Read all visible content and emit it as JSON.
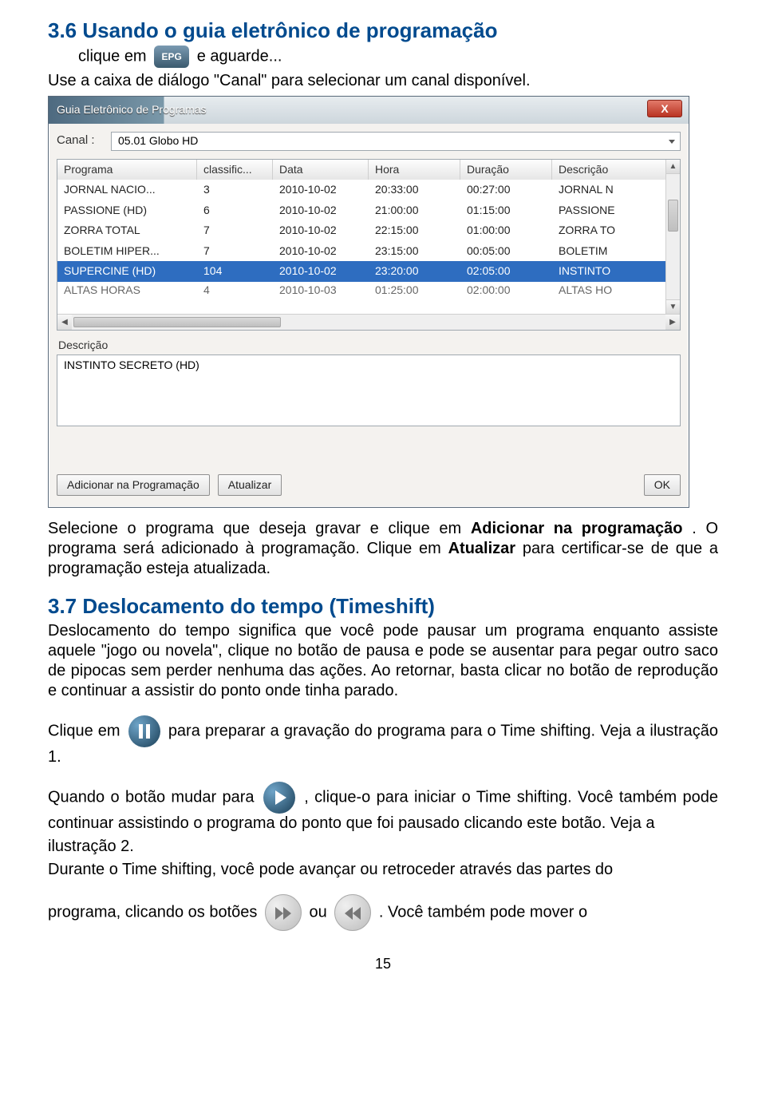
{
  "section36_title": "3.6 Usando o guia eletrônico de programação",
  "line36a_part1": "clique em ",
  "epg_icon_label": "EPG",
  "line36a_part2": " e  aguarde...",
  "line36b": "Use a caixa de diálogo \"Canal\" para selecionar um canal disponível.",
  "dialog": {
    "title": "Guia Eletrônico de Programas",
    "close": "X",
    "channel_label": "Canal :",
    "channel_value": "05.01 Globo HD",
    "columns": {
      "c0": "Programa",
      "c1": "classific...",
      "c2": "Data",
      "c3": "Hora",
      "c4": "Duração",
      "c5": "Descrição"
    },
    "rows": [
      {
        "c0": "JORNAL  NACIO...",
        "c1": "3",
        "c2": "2010-10-02",
        "c3": "20:33:00",
        "c4": "00:27:00",
        "c5": "JORNAL N"
      },
      {
        "c0": "PASSIONE (HD)",
        "c1": "6",
        "c2": "2010-10-02",
        "c3": "21:00:00",
        "c4": "01:15:00",
        "c5": "PASSIONE"
      },
      {
        "c0": "ZORRA TOTAL",
        "c1": "7",
        "c2": "2010-10-02",
        "c3": "22:15:00",
        "c4": "01:00:00",
        "c5": "ZORRA TO"
      },
      {
        "c0": "BOLETIM HIPER...",
        "c1": "7",
        "c2": "2010-10-02",
        "c3": "23:15:00",
        "c4": "00:05:00",
        "c5": "BOLETIM"
      },
      {
        "c0": "SUPERCINE (HD)",
        "c1": "104",
        "c2": "2010-10-02",
        "c3": "23:20:00",
        "c4": "02:05:00",
        "c5": "INSTINTO"
      },
      {
        "c0": "ALTAS HORAS",
        "c1": "4",
        "c2": "2010-10-03",
        "c3": "01:25:00",
        "c4": "02:00:00",
        "c5": "ALTAS HO"
      }
    ],
    "desc_label": "Descrição",
    "desc_value": "INSTINTO SECRETO (HD)",
    "btn_add": "Adicionar na Programação",
    "btn_refresh": "Atualizar",
    "btn_ok": "OK"
  },
  "after_dialog_p": "Selecione o programa que deseja gravar e clique em ",
  "after_dialog_bold1": "Adicionar na programação",
  "after_dialog_p2": ". O programa será adicionado à programação. Clique em ",
  "after_dialog_bold2": "Atualizar",
  "after_dialog_p3": " para certificar-se de que a programação esteja atualizada.",
  "section37_title": "3.7 Deslocamento do tempo (Timeshift)",
  "section37_body": "Deslocamento do tempo significa que você pode pausar um programa enquanto assiste aquele \"jogo ou novela\", clique no botão de pausa e pode se ausentar para pegar outro saco de pipocas sem perder nenhuma das ações. Ao retornar, basta clicar no botão de reprodução e continuar a assistir do ponto onde tinha parado.",
  "p_pause_pre": "Clique em ",
  "p_pause_post": " para preparar a gravação do programa para o Time shifting. Veja a ilustração 1.",
  "p_play_pre": "Quando o botão mudar para ",
  "p_play_post": ", clique-o para iniciar o Time shifting. Você também pode continuar assistindo o programa do ponto que foi pausado clicando este botão. Veja a",
  "p_illus2": "ilustração 2.",
  "p_ffrw": "Durante o Time shifting, você pode avançar ou retroceder através das partes do",
  "p_ffrw2_pre": "programa, clicando os botões ",
  "p_ffrw2_mid": " ou ",
  "p_ffrw2_post": ". Você também pode mover o",
  "page_number": "15"
}
